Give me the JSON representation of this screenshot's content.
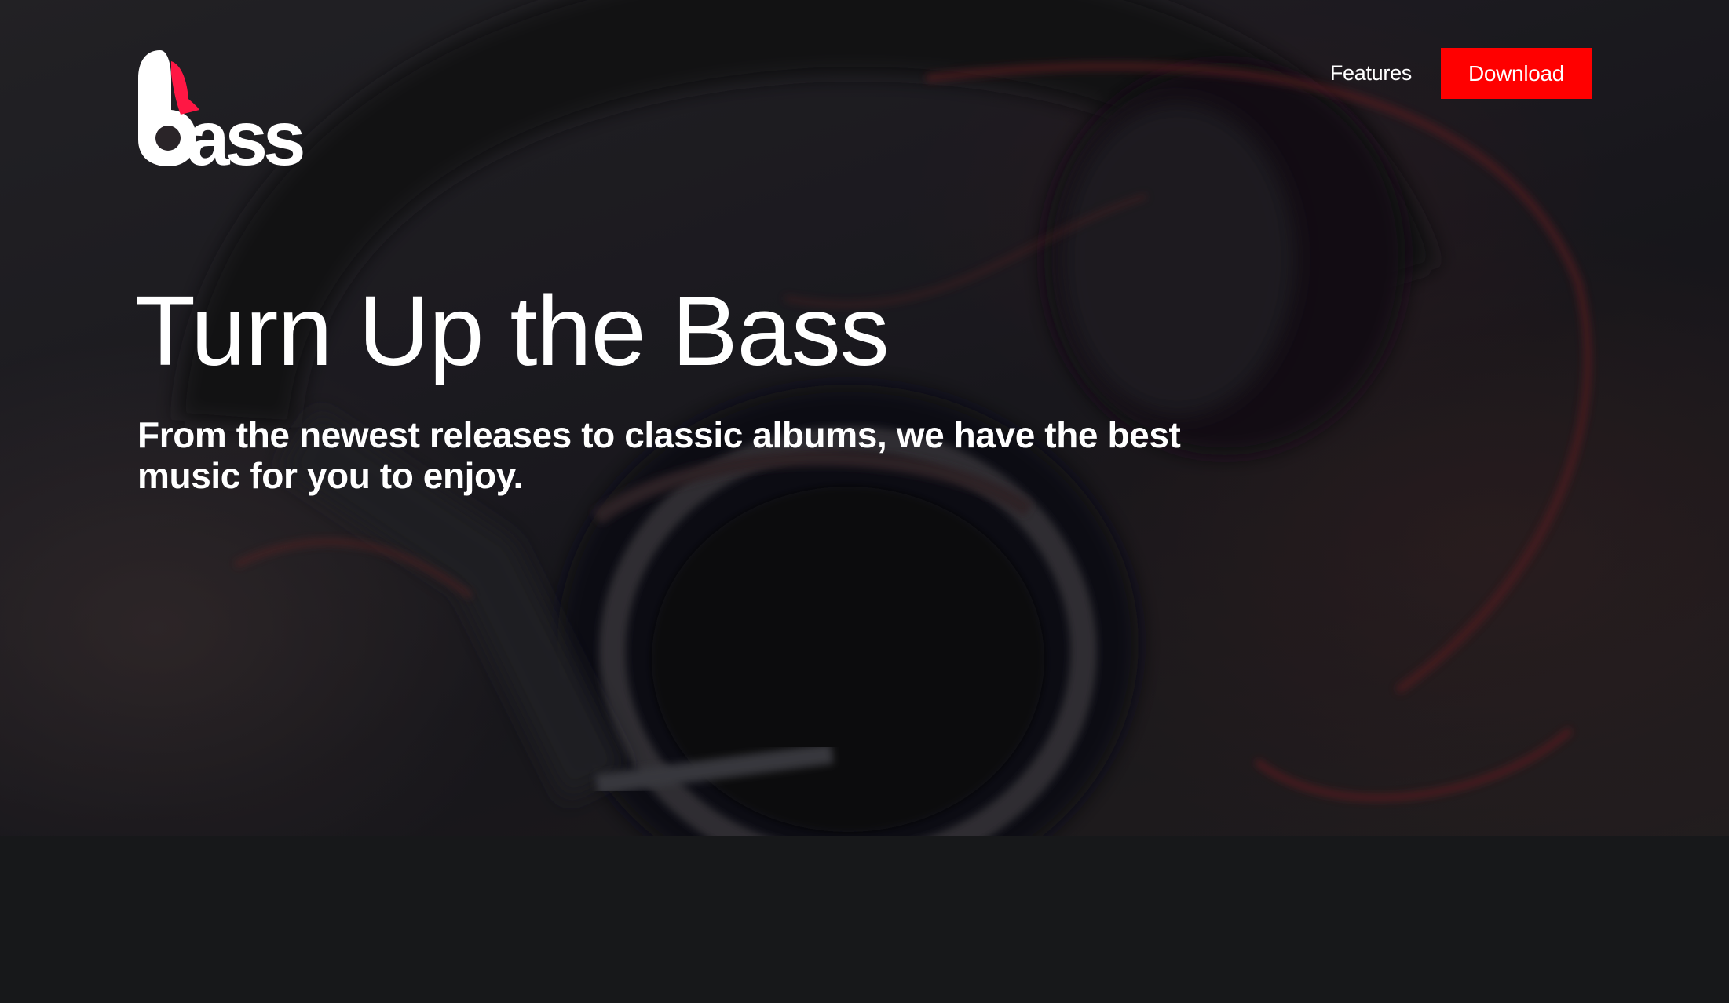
{
  "brand": {
    "logo_text": "bass",
    "accent_color": "#ff0000",
    "logo_icon": "headphone-b-logo-icon"
  },
  "nav": {
    "features_label": "Features",
    "download_label": "Download"
  },
  "hero": {
    "headline": "Turn Up the Bass",
    "subheadline": "From the newest releases to classic albums, we have the best music for you to enjoy.",
    "background_image": "headphones-photo"
  },
  "colors": {
    "page_background": "#17181a",
    "text": "#ffffff",
    "button": "#ff0000"
  }
}
